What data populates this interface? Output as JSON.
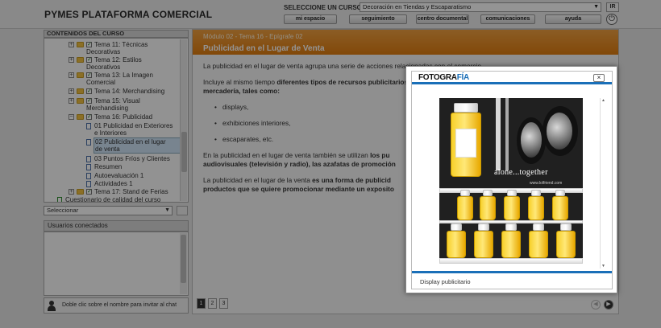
{
  "app": {
    "title": "PYMES PLATAFORMA COMERCIAL",
    "course_label": "SELECCIONE UN CURSO:",
    "course_value": "Decoración en Tiendas y Escaparatismo",
    "ir_button": "IR",
    "nav": [
      "mi espacio",
      "seguimiento",
      "centro documental",
      "comunicaciones",
      "ayuda"
    ]
  },
  "sidebar": {
    "title": "CONTENIDOS DEL CURSO",
    "items": [
      {
        "label": "Tema 11: Técnicas",
        "label2": "Decorativas"
      },
      {
        "label": "Tema 12: Estilos",
        "label2": "Decorativos"
      },
      {
        "label": "Tema 13: La Imagen",
        "label2": "Comercial"
      },
      {
        "label": "Tema 14: Merchandising"
      },
      {
        "label": "Tema 15: Visual",
        "label2": "Merchandising"
      },
      {
        "label": "Tema 16: Publicidad"
      },
      {
        "label": "01 Publicidad en Exteriores",
        "label2": "e Interiores"
      },
      {
        "label": "02 Publicidad en el lugar",
        "label2": "de venta"
      },
      {
        "label": "03 Puntos Fríos y Clientes"
      },
      {
        "label": "Resumen"
      },
      {
        "label": "Autoevaluación 1"
      },
      {
        "label": "Actividades 1"
      },
      {
        "label": "Tema 17: Stand de Ferias"
      },
      {
        "label": "Cuestionario de calidad del curso"
      }
    ],
    "select_value": "Seleccionar",
    "users_title": "Usuarios conectados",
    "chat_hint": "Doble clic sobre el nombre para invitar al chat"
  },
  "main": {
    "breadcrumb": "Módulo 02 - Tema 16 - Epígrafe 02",
    "title": "Publicidad en el Lugar de Venta",
    "p1": "La publicidad en el lugar de venta agrupa una serie de acciones relacionadas con el comercio",
    "p2_normal": "Incluye al mismo tiempo ",
    "p2_bold": "diferentes tipos de recursos publicitarios",
    "p2_line2": "mercadería, tales como:",
    "bullets": [
      "displays,",
      "exhibiciones interiores,",
      "escaparates, etc."
    ],
    "p3_normal": "En la publicidad en el lugar de venta también se utilizan ",
    "p3_bold": "los pu",
    "p3_line2": "audiovisuales (televisión y radio), las azafatas de promoción",
    "p4_normal": "La publicidad en el lugar de la venta ",
    "p4_bold": "es una forma de publicid",
    "p4_line2": "productos que se quiere promocionar mediante un exposito",
    "pages": [
      "1",
      "2",
      "3"
    ]
  },
  "modal": {
    "logo_main": "FOTOGRA",
    "logo_accent": "FÍA",
    "close": "×",
    "slogan": "alone...together",
    "url": "www.lolfriend.com",
    "caption": "Display publicitario"
  },
  "colors": {
    "header_orange": "#e8861e",
    "accent_blue": "#1a6fb8"
  }
}
